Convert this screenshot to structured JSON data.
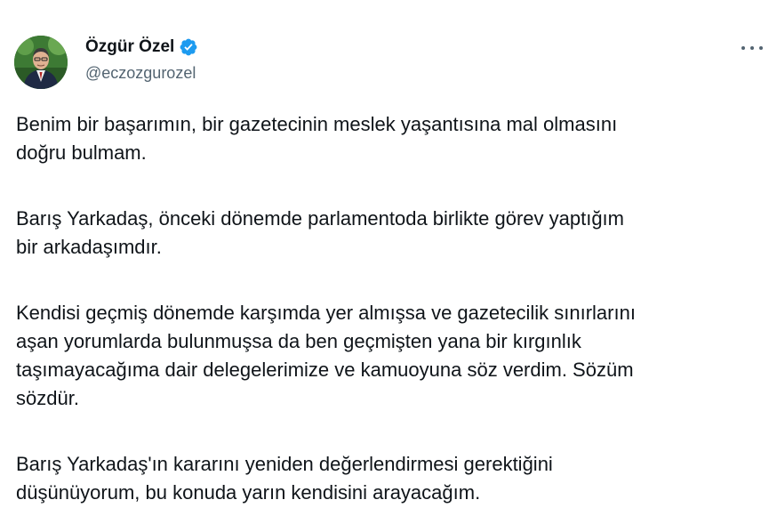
{
  "tweet": {
    "author": {
      "display_name": "Özgür Özel",
      "handle": "@eczozgurozel",
      "verified": true,
      "verified_color": "#1d9bf0"
    },
    "icons": {
      "avatar": "profile-photo",
      "verified": "verified-badge-icon",
      "more": "more-options-icon"
    },
    "paragraphs": [
      "Benim bir başarımın, bir gazetecinin meslek yaşantısına mal olmasını\ndoğru bulmam.",
      "Barış Yarkadaş, önceki dönemde parlamentoda birlikte görev yaptığım\nbir arkadaşımdır.",
      "Kendisi geçmiş dönemde karşımda yer almışsa ve gazetecilik sınırlarını\naşan yorumlarda bulunmuşsa da ben geçmişten yana bir kırgınlık\ntaşımayacağıma dair delegelerimize ve kamuoyuna söz verdim. Sözüm\nsözdür.",
      "Barış Yarkadaş'ın kararını yeniden değerlendirmesi gerektiğini\ndüşünüyorum, bu konuda yarın kendisini arayacağım."
    ]
  }
}
